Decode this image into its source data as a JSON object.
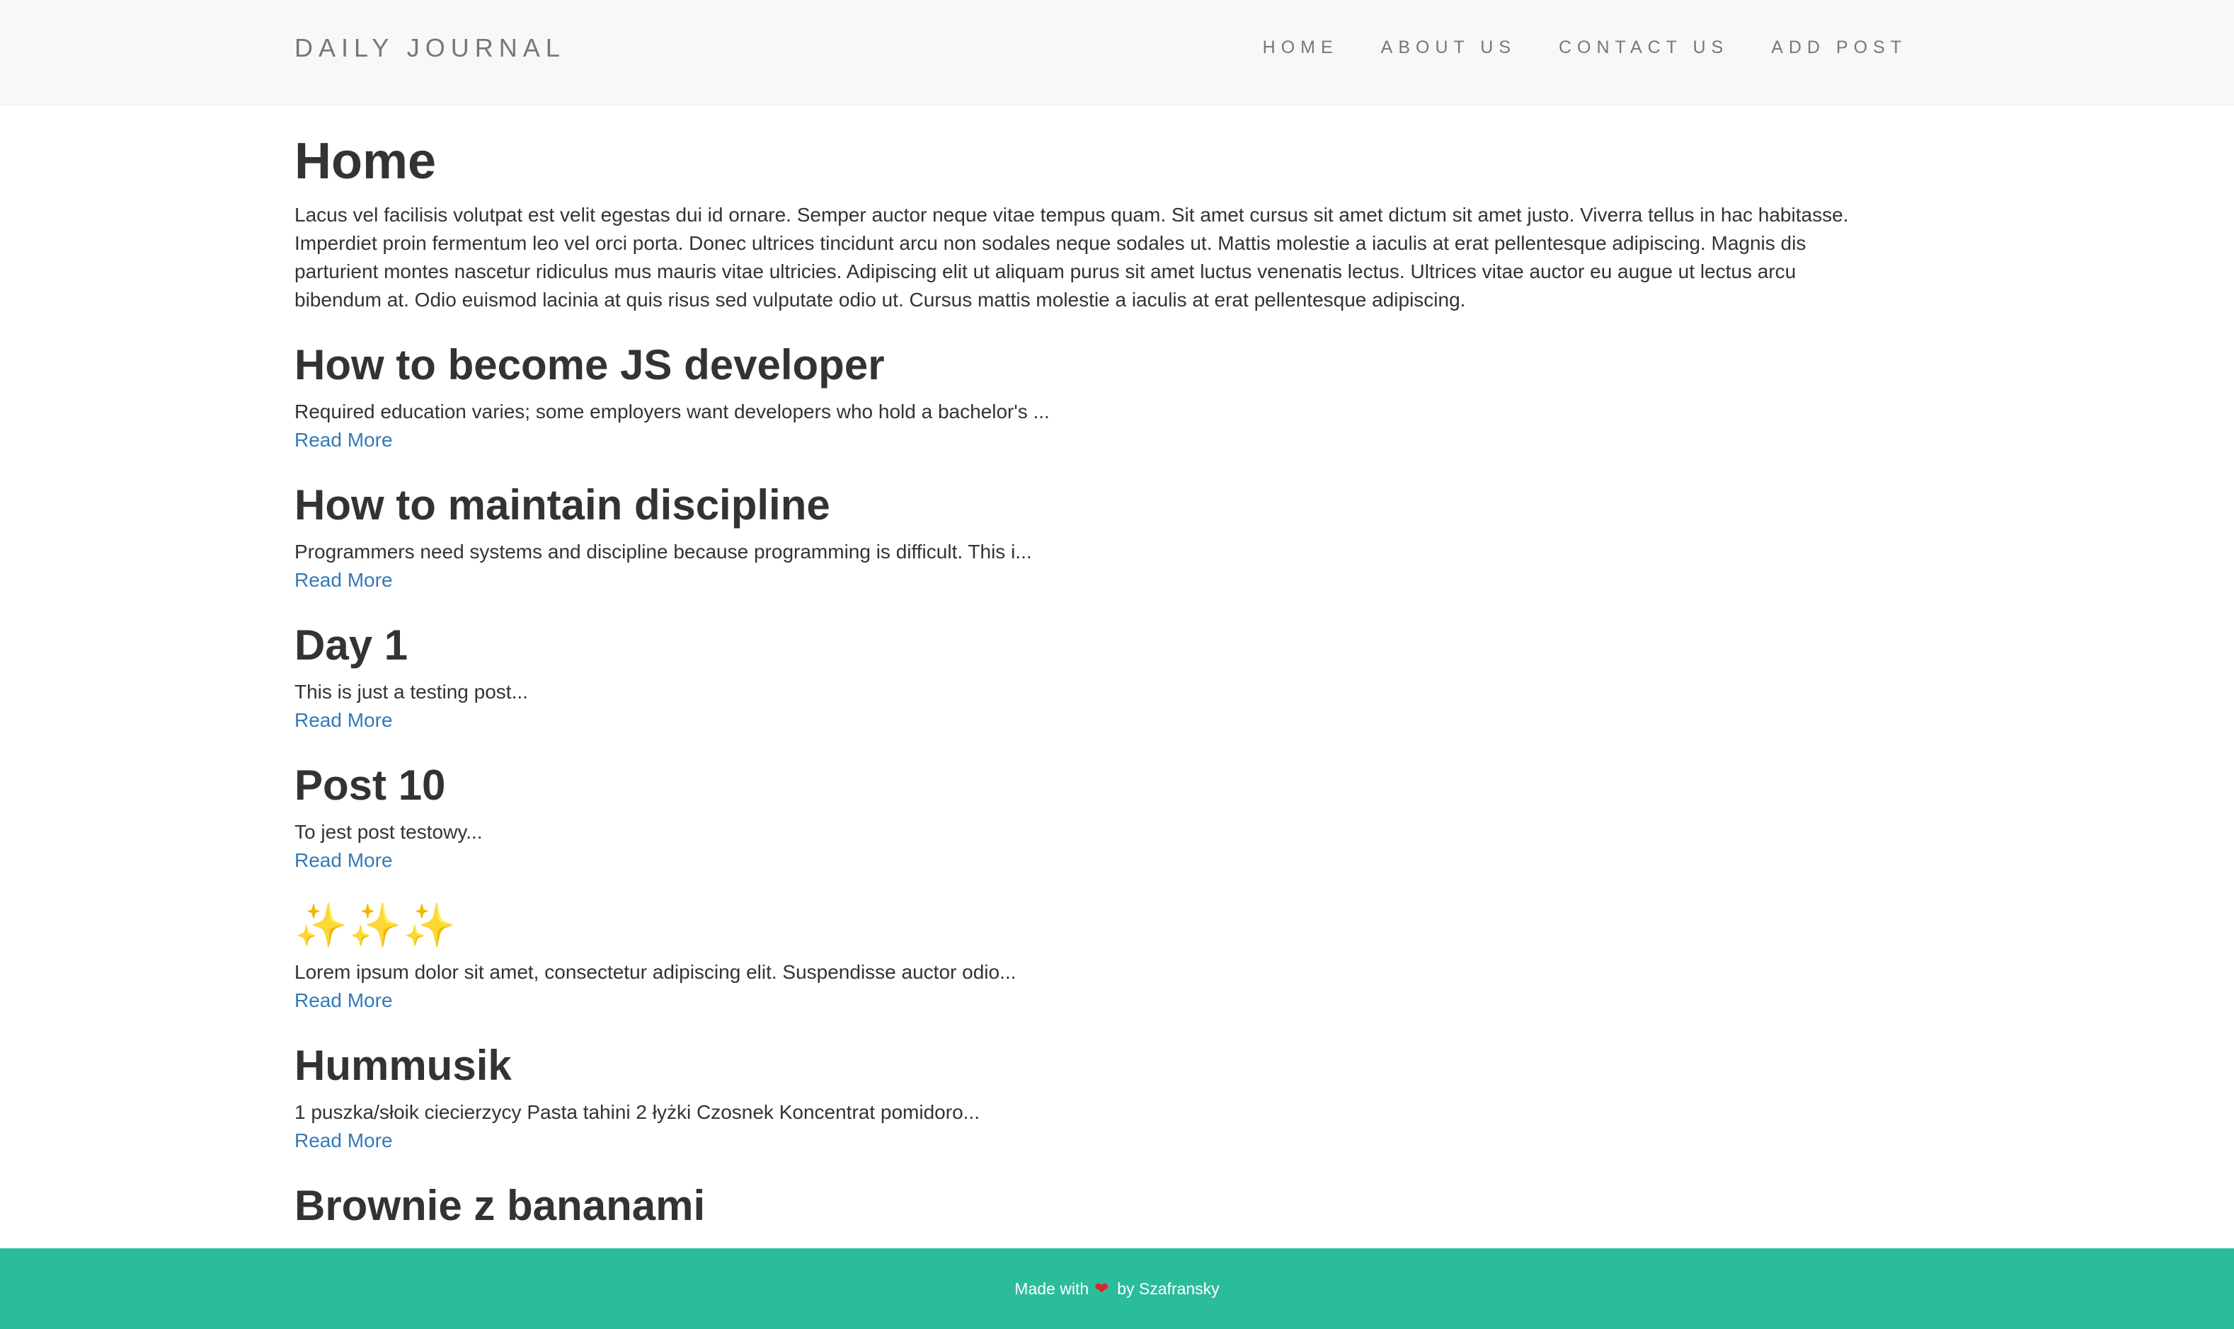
{
  "navbar": {
    "brand": "DAILY JOURNAL",
    "links": [
      {
        "label": "HOME"
      },
      {
        "label": "ABOUT US"
      },
      {
        "label": "CONTACT US"
      },
      {
        "label": "ADD POST"
      }
    ]
  },
  "main": {
    "title": "Home",
    "intro": "Lacus vel facilisis volutpat est velit egestas dui id ornare. Semper auctor neque vitae tempus quam. Sit amet cursus sit amet dictum sit amet justo. Viverra tellus in hac habitasse. Imperdiet proin fermentum leo vel orci porta. Donec ultrices tincidunt arcu non sodales neque sodales ut. Mattis molestie a iaculis at erat pellentesque adipiscing. Magnis dis parturient montes nascetur ridiculus mus mauris vitae ultricies. Adipiscing elit ut aliquam purus sit amet luctus venenatis lectus. Ultrices vitae auctor eu augue ut lectus arcu bibendum at. Odio euismod lacinia at quis risus sed vulputate odio ut. Cursus mattis molestie a iaculis at erat pellentesque adipiscing.",
    "posts": [
      {
        "title": "How to become JS developer",
        "excerpt": "Required education varies; some employers want developers who hold a bachelor's ...",
        "link": "Read More"
      },
      {
        "title": "How to maintain discipline",
        "excerpt": "Programmers need systems and discipline because programming is difficult. This i...",
        "link": "Read More"
      },
      {
        "title": "Day 1",
        "excerpt": "This is just a testing post...",
        "link": "Read More"
      },
      {
        "title": "Post 10",
        "excerpt": "To jest post testowy...",
        "link": "Read More"
      },
      {
        "title": "✨✨✨",
        "excerpt": "Lorem ipsum dolor sit amet, consectetur adipiscing elit. Suspendisse auctor odio...",
        "link": "Read More"
      },
      {
        "title": "Hummusik",
        "excerpt": "1 puszka/słoik ciecierzycy Pasta tahini 2 łyżki Czosnek Koncentrat pomidoro...",
        "link": "Read More"
      },
      {
        "title": "Brownie z bananami"
      }
    ]
  },
  "footer": {
    "prefix": "Made with",
    "heart": "❤",
    "suffix": "by Szafransky"
  },
  "colors": {
    "accent": "#2bbc9b",
    "link": "#337ab7",
    "navbar_bg": "#f8f8f8"
  }
}
